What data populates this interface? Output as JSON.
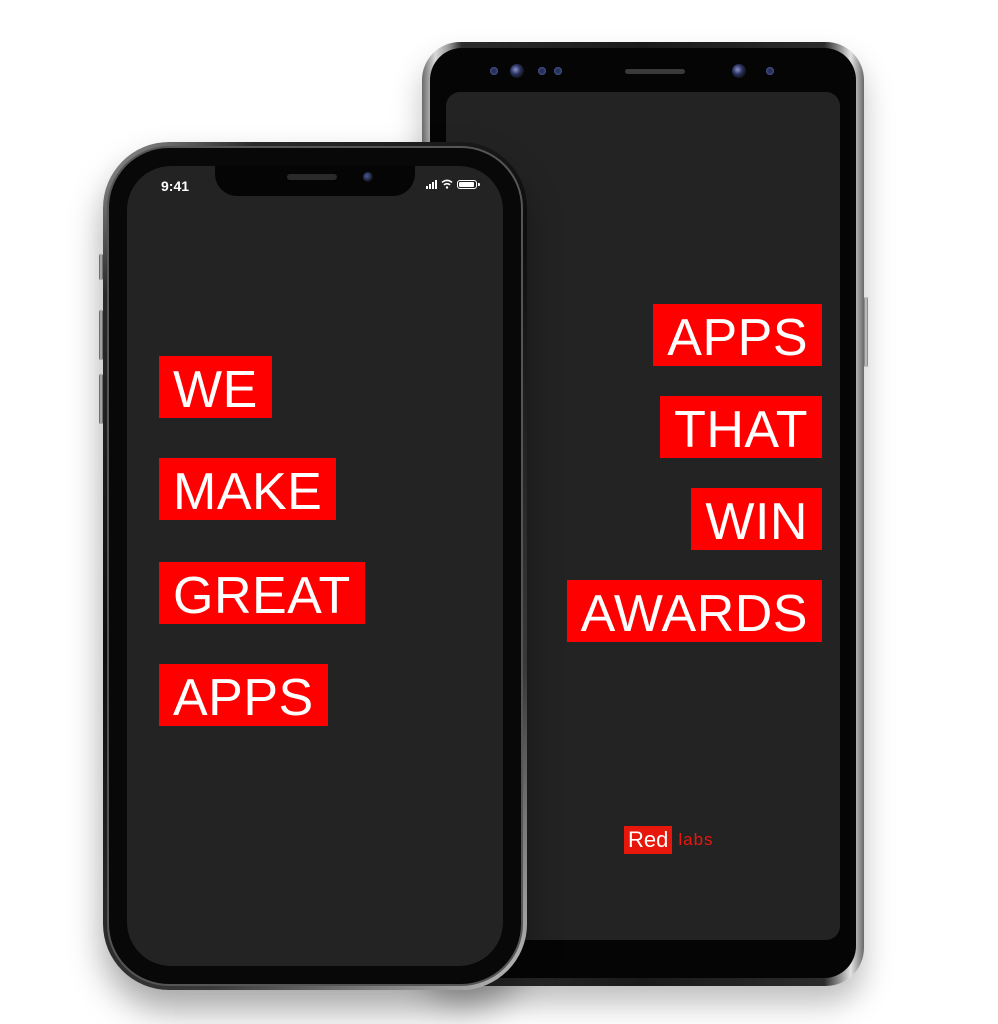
{
  "android_phone": {
    "headline_lines": [
      "APPS",
      "THAT",
      "WIN",
      "AWARDS"
    ],
    "logo": {
      "red_text": "Red",
      "labs_text": "labs",
      "accent_color": "#e8170c"
    },
    "nav_icon": "recent-apps-icon"
  },
  "iphone": {
    "status_bar": {
      "time": "9:41",
      "icons": [
        "signal-icon",
        "wifi-icon",
        "battery-icon"
      ]
    },
    "headline_lines": [
      "WE",
      "MAKE",
      "GREAT",
      "APPS"
    ]
  },
  "colors": {
    "label_background": "#fe0000",
    "label_text": "#ffffff",
    "screen_background": "#232323",
    "page_background": "#ffffff"
  }
}
